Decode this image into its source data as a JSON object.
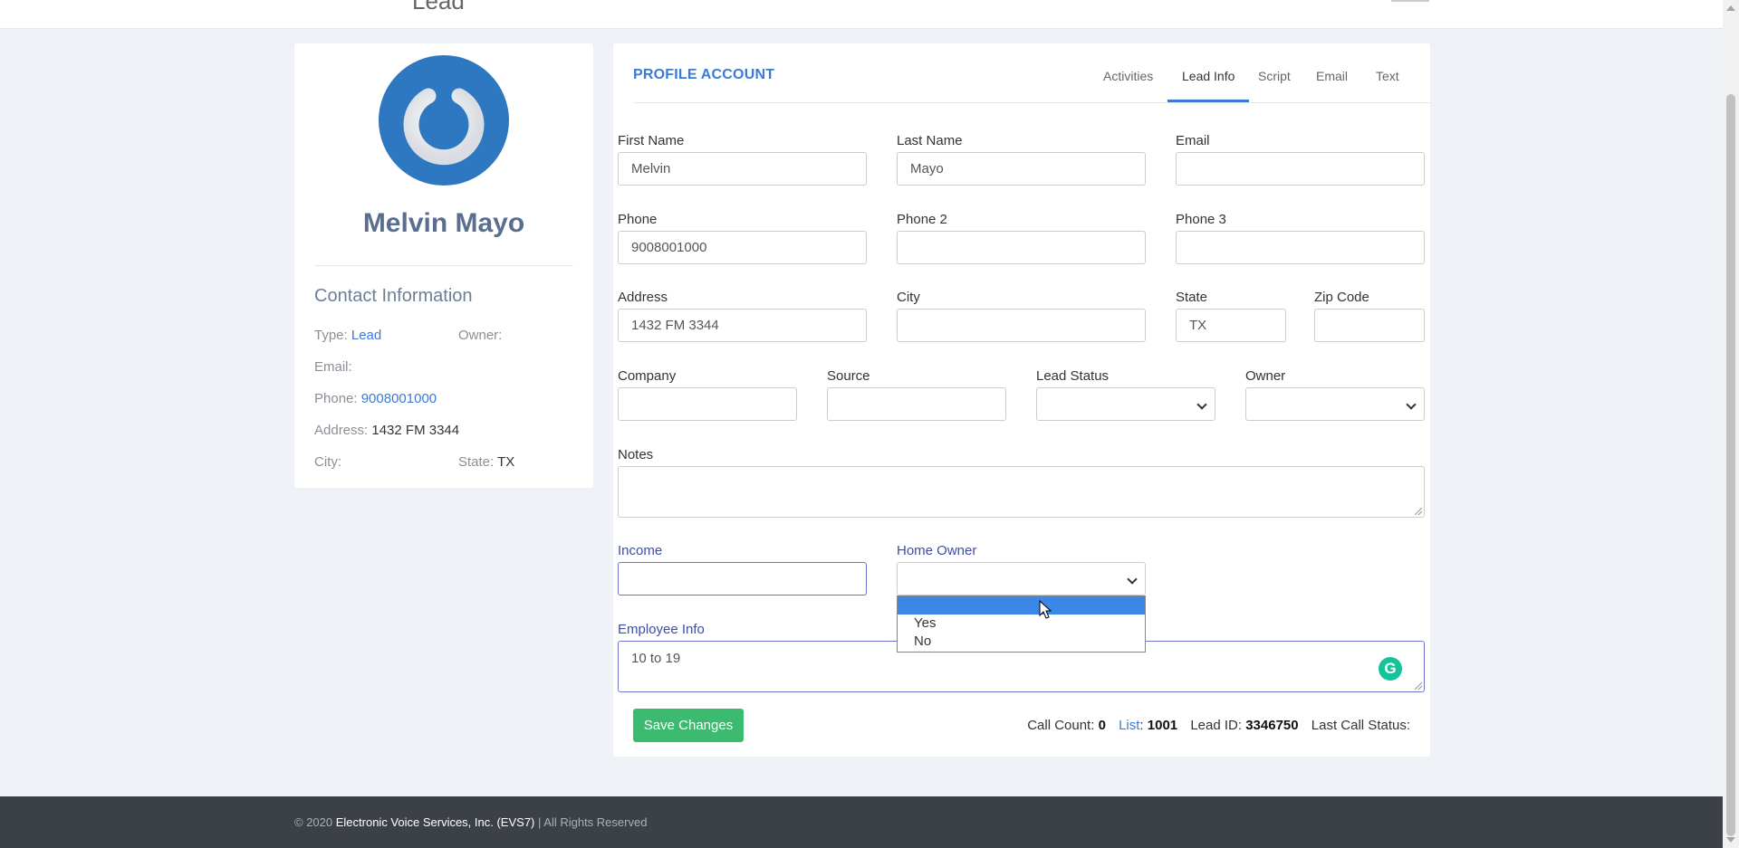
{
  "header": {
    "title": "Lead"
  },
  "profile": {
    "name": "Melvin Mayo",
    "contact_title": "Contact Information",
    "type_label": "Type:",
    "type_value": "Lead",
    "owner_label": "Owner:",
    "owner_value": "",
    "email_label": "Email:",
    "email_value": "",
    "phone_label": "Phone:",
    "phone_value": "9008001000",
    "address_label": "Address:",
    "address_value": "1432 FM 3344",
    "city_label": "City:",
    "city_value": "",
    "state_label": "State:",
    "state_value": "TX"
  },
  "main": {
    "section_title": "PROFILE ACCOUNT",
    "tabs": [
      {
        "label": "Activities"
      },
      {
        "label": "Lead Info"
      },
      {
        "label": "Script"
      },
      {
        "label": "Email"
      },
      {
        "label": "Text"
      }
    ],
    "active_tab": "Lead Info"
  },
  "form": {
    "first_name": {
      "label": "First Name",
      "value": "Melvin"
    },
    "last_name": {
      "label": "Last Name",
      "value": "Mayo"
    },
    "email": {
      "label": "Email",
      "value": ""
    },
    "phone": {
      "label": "Phone",
      "value": "9008001000"
    },
    "phone2": {
      "label": "Phone 2",
      "value": ""
    },
    "phone3": {
      "label": "Phone 3",
      "value": ""
    },
    "address": {
      "label": "Address",
      "value": "1432 FM 3344"
    },
    "city": {
      "label": "City",
      "value": ""
    },
    "state": {
      "label": "State",
      "value": "TX"
    },
    "zip": {
      "label": "Zip Code",
      "value": ""
    },
    "company": {
      "label": "Company",
      "value": ""
    },
    "source": {
      "label": "Source",
      "value": ""
    },
    "lead_status": {
      "label": "Lead Status",
      "value": ""
    },
    "owner": {
      "label": "Owner",
      "value": ""
    },
    "notes": {
      "label": "Notes",
      "value": ""
    },
    "income": {
      "label": "Income",
      "value": ""
    },
    "home_owner": {
      "label": "Home Owner",
      "value": "",
      "options": [
        "",
        "Yes",
        "No"
      ]
    },
    "employee_info": {
      "label": "Employee Info",
      "value": "10 to 19"
    }
  },
  "actions": {
    "save_label": "Save Changes"
  },
  "stats": {
    "call_count_label": "Call Count:",
    "call_count": "0",
    "list_label": "List",
    "list_value": "1001",
    "lead_id_label": "Lead ID:",
    "lead_id": "3346750",
    "last_call_label": "Last Call Status:",
    "last_call": ""
  },
  "footer": {
    "prefix": "© 2020 ",
    "company": "Electronic Voice Services, Inc. (EVS7)",
    "suffix": " | All Rights Reserved"
  },
  "icons": {
    "avatar": "power-icon",
    "grammarly": "grammarly-icon",
    "cursor": "mouse-cursor-icon"
  },
  "colors": {
    "accent": "#3a7bd5",
    "save": "#3cba6f",
    "avatar": "#2e78c2",
    "footer": "#3c4148"
  }
}
